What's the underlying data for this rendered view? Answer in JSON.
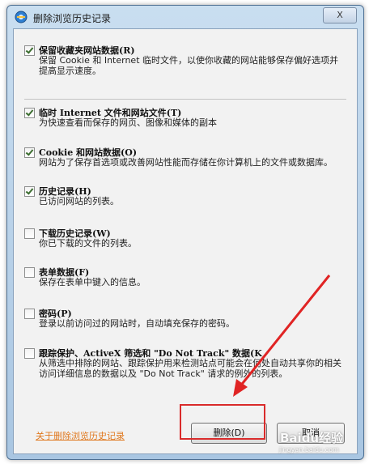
{
  "window": {
    "title": "删除浏览历史记录",
    "close_label": "X"
  },
  "options": [
    {
      "title": "保留收藏夹网站数据(R)",
      "checked": true,
      "desc": "保留 Cookie 和 Internet 临时文件，以使你收藏的网站能够保存偏好选项并提高显示速度。"
    },
    {
      "title": "临时 Internet 文件和网站文件(T)",
      "checked": true,
      "desc": "为快速查看而保存的网页、图像和媒体的副本"
    },
    {
      "title": "Cookie 和网站数据(O)",
      "checked": true,
      "desc": "网站为了保存首选项或改善网站性能而存储在你计算机上的文件或数据库。"
    },
    {
      "title": "历史记录(H)",
      "checked": true,
      "desc": "已访问网站的列表。"
    },
    {
      "title": "下载历史记录(W)",
      "checked": false,
      "desc": "你已下载的文件的列表。"
    },
    {
      "title": "表单数据(F)",
      "checked": false,
      "desc": "保存在表单中键入的信息。"
    },
    {
      "title": "密码(P)",
      "checked": false,
      "desc": "登录以前访问过的网站时，自动填充保存的密码。"
    },
    {
      "title": "跟踪保护、ActiveX 筛选和 \"Do Not Track\" 数据(K",
      "checked": false,
      "desc": "从筛选中排除的网站、跟踪保护用来检测站点可能会在何处自动共享你的相关访问详细信息的数据以及 \"Do Not Track\" 请求的例外的列表。"
    }
  ],
  "footer": {
    "help_link": "关于删除浏览历史记录",
    "delete_label": "删除(D)",
    "cancel_label": "取消"
  },
  "annotation": {
    "highlight_color": "#d92b2b"
  },
  "watermark": {
    "main": "Baidu经验",
    "sub": "jingyan.baidu.com"
  }
}
